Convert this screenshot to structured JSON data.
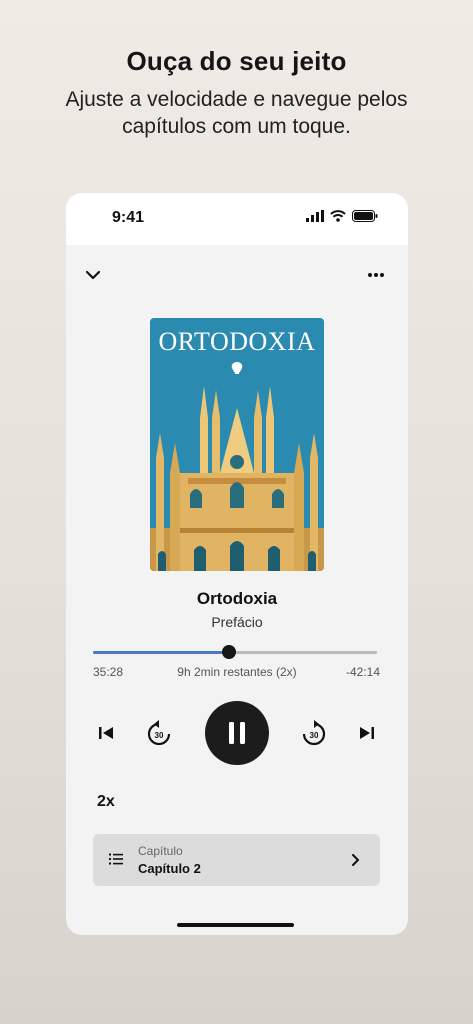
{
  "promo": {
    "headline": "Ouça do seu jeito",
    "subheadline": "Ajuste a velocidade e navegue pelos capítulos com um toque."
  },
  "status_bar": {
    "time": "9:41"
  },
  "player": {
    "cover_title": "ORTODOXIA",
    "book_title": "Ortodoxia",
    "chapter": "Prefácio",
    "progress_fraction": 0.48,
    "elapsed": "35:28",
    "remaining_info": "9h 2min restantes (2x)",
    "remaining": "-42:14",
    "skip_back_seconds": "30",
    "skip_forward_seconds": "30",
    "speed": "2x",
    "chapter_selector": {
      "label": "Capítulo",
      "value": "Capítulo 2"
    }
  },
  "colors": {
    "progress_fill": "#4d79c7",
    "play_button": "#1c1c1c",
    "cover_background": "#2a8ab0"
  }
}
